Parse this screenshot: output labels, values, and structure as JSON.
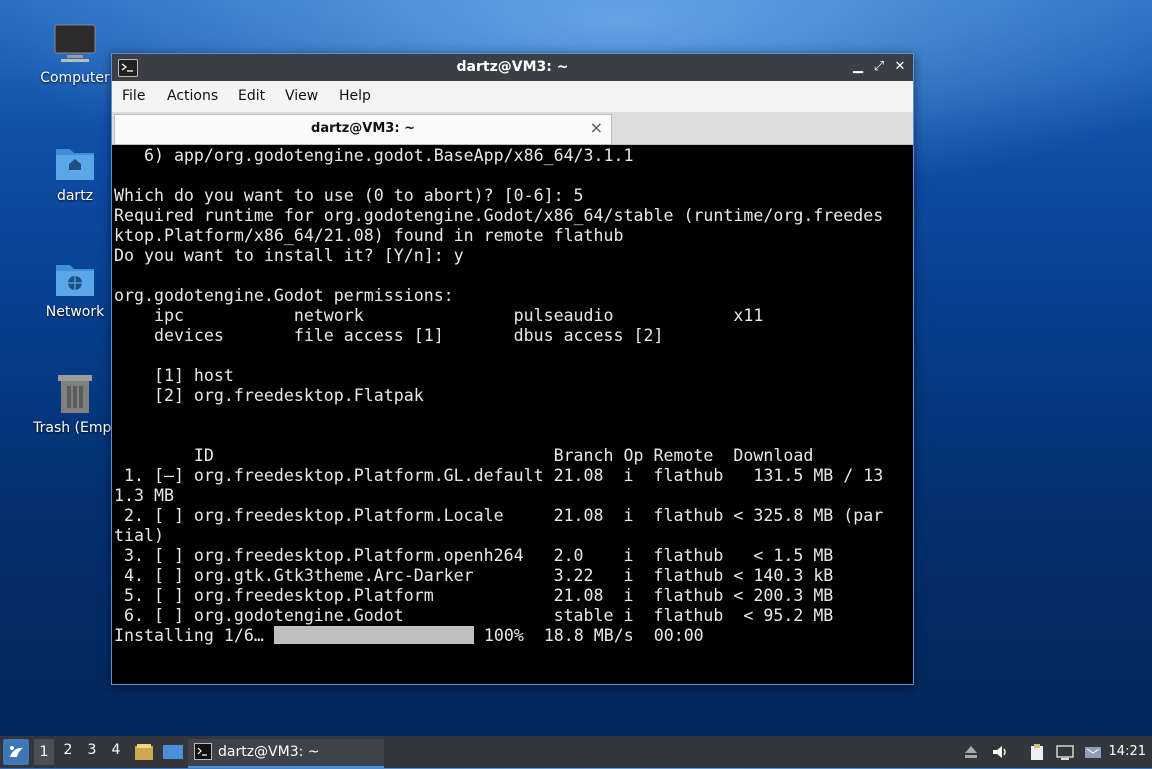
{
  "desktop": {
    "icons": [
      {
        "label": "Computer"
      },
      {
        "label": "dartz"
      },
      {
        "label": "Network"
      },
      {
        "label": "Trash (Empt"
      }
    ]
  },
  "window": {
    "title": "dartz@VM3: ~",
    "menu": [
      "File",
      "Actions",
      "Edit",
      "View",
      "Help"
    ],
    "tab": {
      "title": "dartz@VM3: ~",
      "close": "×"
    },
    "controls": {
      "minimize": "▁",
      "restore": "⤢",
      "close": "✕"
    }
  },
  "terminal": {
    "lines": [
      "   6) app/org.godotengine.godot.BaseApp/x86_64/3.1.1",
      "",
      "Which do you want to use (0 to abort)? [0-6]: 5",
      "Required runtime for org.godotengine.Godot/x86_64/stable (runtime/org.freedes",
      "ktop.Platform/x86_64/21.08) found in remote flathub",
      "Do you want to install it? [Y/n]: y",
      "",
      "org.godotengine.Godot permissions:",
      "    ipc           network               pulseaudio            x11",
      "    devices       file access [1]       dbus access [2]",
      "",
      "    [1] host",
      "    [2] org.freedesktop.Flatpak",
      "",
      "",
      "        ID                                  Branch Op Remote  Download",
      " 1. [—] org.freedesktop.Platform.GL.default 21.08  i  flathub   131.5 MB / 13",
      "1.3 MB",
      " 2. [ ] org.freedesktop.Platform.Locale     21.08  i  flathub < 325.8 MB (par",
      "tial)",
      " 3. [ ] org.freedesktop.Platform.openh264   2.0    i  flathub   < 1.5 MB",
      " 4. [ ] org.gtk.Gtk3theme.Arc-Darker        3.22   i  flathub < 140.3 kB",
      " 5. [ ] org.freedesktop.Platform            21.08  i  flathub < 200.3 MB",
      " 6. [ ] org.godotengine.Godot               stable i  flathub  < 95.2 MB",
      ""
    ],
    "progress": {
      "label": "Installing 1/6…",
      "percent_text": "100%",
      "speed": "18.8 MB/s",
      "time": "00:00",
      "fraction": 1.0
    }
  },
  "taskbar": {
    "workspaces": [
      "1",
      "2",
      "3",
      "4"
    ],
    "active_workspace": "1",
    "task_label": "dartz@VM3: ~",
    "clock": "14:21",
    "tray_icons": [
      "eject-icon",
      "volume-icon",
      "clipboard-icon",
      "network-icon",
      "notification-icon"
    ]
  },
  "colors": {
    "accent": "#4a90d9",
    "terminal_bg": "#000000",
    "terminal_fg": "#e8e8e8",
    "titlebar": "#3b3f45",
    "taskbar": "#33373c"
  }
}
